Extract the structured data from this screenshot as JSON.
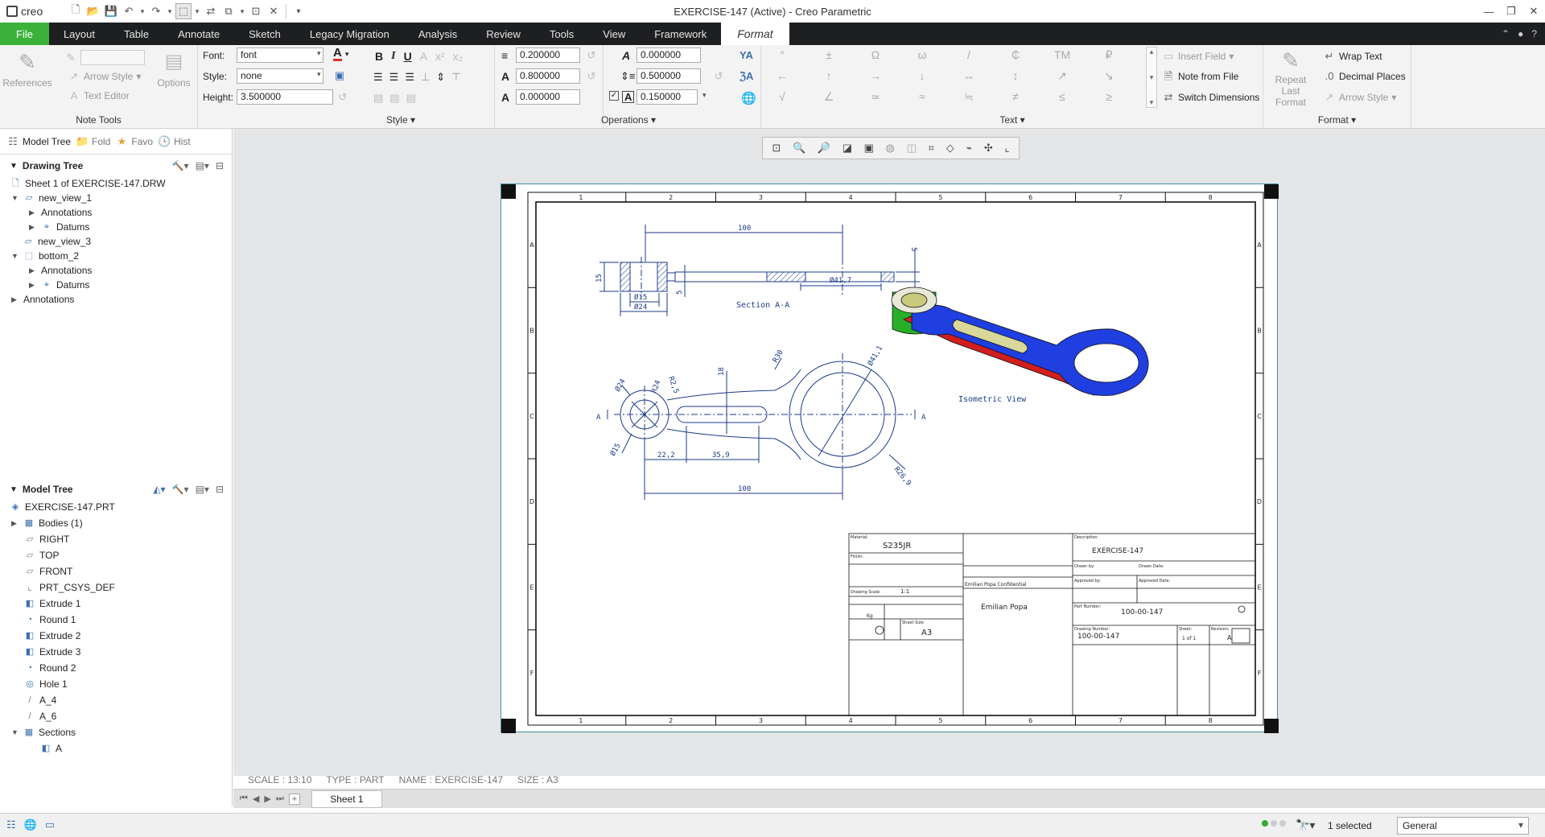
{
  "app": {
    "logo": "creo",
    "title": "EXERCISE-147 (Active) - Creo Parametric"
  },
  "menu": {
    "tabs": [
      {
        "label": "File"
      },
      {
        "label": "Layout"
      },
      {
        "label": "Table"
      },
      {
        "label": "Annotate"
      },
      {
        "label": "Sketch"
      },
      {
        "label": "Legacy Migration"
      },
      {
        "label": "Analysis"
      },
      {
        "label": "Review"
      },
      {
        "label": "Tools"
      },
      {
        "label": "View"
      },
      {
        "label": "Framework"
      },
      {
        "label": "Format"
      }
    ],
    "active": "Format"
  },
  "ribbon": {
    "note_tools": {
      "label": "Note Tools",
      "references": "References",
      "arrow_style": "Arrow Style",
      "text_editor": "Text Editor",
      "options": "Options"
    },
    "style": {
      "label": "Style",
      "font_label": "Font:",
      "font_value": "font",
      "style_label": "Style:",
      "style_value": "none",
      "height_label": "Height:",
      "height_value": "3.500000",
      "text_color": "#d9302c"
    },
    "operations": {
      "label": "Operations",
      "line_spacing": "0.200000",
      "width_factor": "0.800000",
      "thickness": "0.000000",
      "slant_angle": "0.000000",
      "line_height": "0.500000",
      "char_spacing": "0.150000"
    },
    "text": {
      "label": "Text",
      "symbols": [
        "°",
        "±",
        "Ω",
        "ω",
        "/",
        "₵",
        "TM",
        "₽",
        "←",
        "↑",
        "→",
        "↓",
        "↔",
        "↕",
        "↗",
        "↘",
        "√",
        "∠",
        "≃",
        "≈",
        "≒",
        "≠",
        "≤",
        "≥"
      ],
      "insert_field": "Insert Field",
      "note_from_file": "Note from File",
      "switch_dimensions": "Switch Dimensions"
    },
    "format": {
      "label": "Format",
      "repeat_last_format": "Repeat Last Format",
      "wrap_text": "Wrap Text",
      "decimal_places": "Decimal Places",
      "arrow_style": "Arrow Style"
    }
  },
  "panel": {
    "tabs": [
      "Model Tree",
      "Fold",
      "Favo",
      "Hist"
    ],
    "drawing_tree": {
      "title": "Drawing Tree",
      "nodes": [
        {
          "label": "Sheet 1 of EXERCISE-147.DRW"
        },
        {
          "label": "new_view_1"
        },
        {
          "label": "Annotations"
        },
        {
          "label": "Datums"
        },
        {
          "label": "new_view_3"
        },
        {
          "label": "bottom_2"
        },
        {
          "label": "Annotations"
        },
        {
          "label": "Datums"
        },
        {
          "label": "Annotations"
        }
      ]
    },
    "model_tree": {
      "title": "Model Tree",
      "nodes": [
        {
          "label": "EXERCISE-147.PRT"
        },
        {
          "label": "Bodies (1)"
        },
        {
          "label": "RIGHT"
        },
        {
          "label": "TOP"
        },
        {
          "label": "FRONT"
        },
        {
          "label": "PRT_CSYS_DEF"
        },
        {
          "label": "Extrude 1"
        },
        {
          "label": "Round 1"
        },
        {
          "label": "Extrude 2"
        },
        {
          "label": "Extrude 3"
        },
        {
          "label": "Round 2"
        },
        {
          "label": "Hole 1"
        },
        {
          "label": "A_4"
        },
        {
          "label": "A_6"
        },
        {
          "label": "Sections"
        },
        {
          "label": "A"
        }
      ]
    }
  },
  "drawing": {
    "border_cols": [
      "1",
      "2",
      "3",
      "4",
      "5",
      "6",
      "7",
      "8"
    ],
    "border_rows": [
      "A",
      "B",
      "C",
      "D",
      "E",
      "F"
    ],
    "section_label": "Section A-A",
    "iso_label": "Isometric View",
    "dims_section": [
      "100",
      "15",
      "5",
      "Ø15",
      "Ø24",
      "5",
      "Ø41,7"
    ],
    "dims_front": [
      "Ø24",
      "R24",
      "R2,5",
      "18",
      "R30",
      "Ø41,1",
      "Ø15",
      "22,2",
      "35,9",
      "100",
      "R26,9",
      "A",
      "A"
    ],
    "title_block": {
      "material_label": "Material:",
      "material": "S235JR",
      "finish_label": "Finish:",
      "description_label": "Description:",
      "description": "EXERCISE-147",
      "confidential": "Emilian Popa Confidential",
      "drawn_by": "Drawn by:",
      "drawn_date": "Drawn Date:",
      "approved_by": "Approved by:",
      "approved_date": "Approved Date:",
      "drawing_scale_label": "Drawing Scale:",
      "drawing_scale": "1:1",
      "weight": "Kg",
      "sheet_size_label": "Sheet Size:",
      "sheet_size": "A3",
      "author": "Emilian Popa",
      "part_number_label": "Part Number:",
      "part_number": "100-00-147",
      "drawing_number_label": "Drawing Number:",
      "drawing_number": "100-00-147",
      "sheet_label": "Sheet:",
      "sheet": "1 of 1",
      "revision_label": "Revision:",
      "revision": "A"
    },
    "colors": {
      "iso_top": "#1f3fe0",
      "iso_side": "#d21e1e",
      "iso_green": "#27b027",
      "iso_boss": "#d8d89a",
      "line": "#1a3a8a"
    }
  },
  "canvas_info": {
    "scale": "SCALE : 13:10",
    "type": "TYPE : PART",
    "name": "NAME : EXERCISE-147",
    "size": "SIZE : A3"
  },
  "sheet_tabs": {
    "current": "Sheet 1"
  },
  "status": {
    "selected": "1 selected",
    "filter": "General"
  }
}
